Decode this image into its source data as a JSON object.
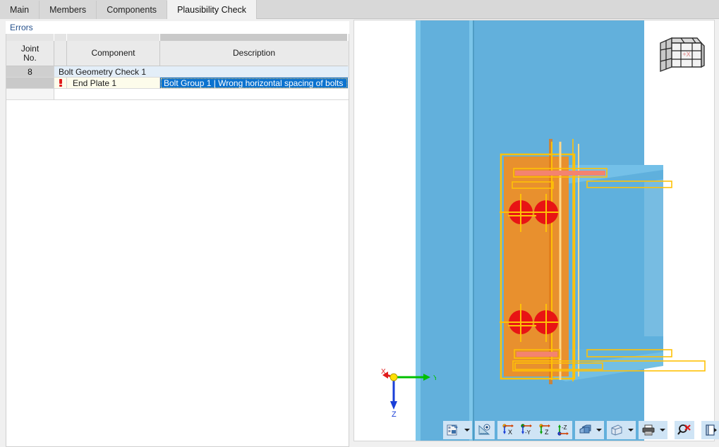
{
  "window": {
    "title": "Plausibility Check"
  },
  "tabs": [
    {
      "label": "Main",
      "active": false
    },
    {
      "label": "Members",
      "active": false
    },
    {
      "label": "Components",
      "active": false
    },
    {
      "label": "Plausibility Check",
      "active": true
    }
  ],
  "panel": {
    "section_title": "Errors",
    "columns": [
      {
        "key": "joint",
        "label": "Joint\nNo.",
        "line1": "Joint",
        "line2": "No."
      },
      {
        "key": "icon",
        "label": ""
      },
      {
        "key": "component",
        "label": "Component"
      },
      {
        "key": "description",
        "label": "Description"
      }
    ],
    "column_headers": {
      "joint_line1": "Joint",
      "joint_line2": "No.",
      "component": "Component",
      "description": "Description"
    },
    "rows": [
      {
        "type": "group",
        "joint_no": "8",
        "icon": "",
        "title": "Bolt Geometry Check 1",
        "description": "",
        "selected": false
      },
      {
        "type": "item",
        "joint_no": "",
        "icon": "error-exclamation-icon",
        "component": "End Plate 1",
        "description": "Bolt Group 1 | Wrong horizontal spacing of bolts",
        "selected": true
      }
    ]
  },
  "viewport": {
    "navigation_cube_label": "+X",
    "axes": [
      {
        "name": "X",
        "label": "X",
        "color": "#e01b1b"
      },
      {
        "name": "Y",
        "label": "Y",
        "color": "#00c000"
      },
      {
        "name": "Z",
        "label": "Z",
        "color": "#1a3fd8"
      }
    ],
    "model": {
      "column_color": "#62b0dc",
      "beam_color": "#7cc6ea",
      "end_plate_color": "#e8902e",
      "bolt_color": "#e81414",
      "highlight_outline_color": "#ffc107",
      "weld_color": "#f08080"
    }
  },
  "toolbar": {
    "buttons": [
      {
        "name": "render-settings-button",
        "icon": "render-settings-icon",
        "has_dropdown": true
      },
      {
        "name": "view-angle-button",
        "icon": "protractor-eye-icon",
        "has_dropdown": false
      },
      {
        "name": "view-x-button",
        "icon": "axis-x-icon",
        "label": "X",
        "has_dropdown": false
      },
      {
        "name": "view-negative-y-button",
        "icon": "axis-negative-y-icon",
        "label": "-Y",
        "has_dropdown": false
      },
      {
        "name": "view-z-button",
        "icon": "axis-z-icon",
        "label": "Z",
        "has_dropdown": false
      },
      {
        "name": "view-negative-z-button",
        "icon": "axis-negative-z-icon",
        "label": "-Z",
        "has_dropdown": false
      },
      {
        "name": "shading-mode-button",
        "icon": "solid-blocks-icon",
        "has_dropdown": true
      },
      {
        "name": "wireframe-mode-button",
        "icon": "wireframe-cube-icon",
        "has_dropdown": true
      },
      {
        "name": "print-button",
        "icon": "printer-icon",
        "has_dropdown": true
      },
      {
        "name": "reset-zoom-button",
        "icon": "magnifier-cancel-icon",
        "has_dropdown": false
      },
      {
        "name": "expand-panel-button",
        "icon": "panel-expand-icon",
        "has_dropdown": false
      }
    ]
  }
}
